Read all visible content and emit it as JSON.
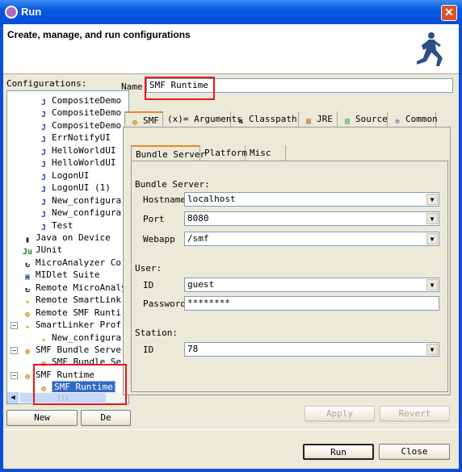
{
  "window": {
    "title": "Run",
    "close_icon": "close-icon"
  },
  "header": {
    "title": "Create, manage, and run configurations",
    "icon": "running-man-icon"
  },
  "configurations": {
    "label": "Configurations:",
    "items": [
      {
        "label": "CompositeDemo",
        "icon": "java-app-icon",
        "level": 2
      },
      {
        "label": "CompositeDemo",
        "icon": "java-app-icon",
        "level": 2
      },
      {
        "label": "CompositeDemo",
        "icon": "java-app-icon",
        "level": 2
      },
      {
        "label": "ErrNotifyUI",
        "icon": "java-app-icon",
        "level": 2
      },
      {
        "label": "HelloWorldUI",
        "icon": "java-app-icon",
        "level": 2
      },
      {
        "label": "HelloWorldUI",
        "icon": "java-app-icon",
        "level": 2
      },
      {
        "label": "LogonUI",
        "icon": "java-app-icon",
        "level": 2
      },
      {
        "label": "LogonUI (1)",
        "icon": "java-app-icon",
        "level": 2
      },
      {
        "label": "New_configura",
        "icon": "java-app-icon",
        "level": 2
      },
      {
        "label": "New_configura",
        "icon": "java-app-icon",
        "level": 2
      },
      {
        "label": "Test",
        "icon": "java-app-icon",
        "level": 2
      },
      {
        "label": "Java on Device",
        "icon": "device-icon",
        "level": 1
      },
      {
        "label": "JUnit",
        "icon": "junit-icon",
        "level": 1
      },
      {
        "label": "MicroAnalyzer Co",
        "icon": "analyzer-icon",
        "level": 1
      },
      {
        "label": "MIDlet Suite",
        "icon": "midlet-icon",
        "level": 1
      },
      {
        "label": "Remote MicroAnaly",
        "icon": "analyzer-icon",
        "level": 1
      },
      {
        "label": "Remote SmartLink",
        "icon": "smartlinker-icon",
        "level": 1
      },
      {
        "label": "Remote SMF Runti",
        "icon": "smf-icon",
        "level": 1
      },
      {
        "label": "SmartLinker Prof",
        "icon": "smartlinker-icon",
        "level": 1,
        "expanded": true
      },
      {
        "label": "New_configura",
        "icon": "smartlinker-icon",
        "level": 2
      },
      {
        "label": "SMF Bundle Serve",
        "icon": "smf-bundle-icon",
        "level": 1,
        "expanded": true
      },
      {
        "label": "SMF Bundle Se",
        "icon": "smf-bundle-icon",
        "level": 2
      },
      {
        "label": "SMF Runtime",
        "icon": "smf-icon",
        "level": 1,
        "expanded": true
      },
      {
        "label": "SMF Runtime",
        "icon": "smf-icon",
        "level": 2,
        "selected": true
      }
    ],
    "new_button": "New",
    "delete_button": "De"
  },
  "name": {
    "label": "Name:",
    "value": "SMF Runtime"
  },
  "tabs": [
    {
      "label": "SMF",
      "icon": "smf-icon",
      "active": true
    },
    {
      "label": "(x)= Arguments"
    },
    {
      "label": "Classpath",
      "icon": "classpath-icon"
    },
    {
      "label": "JRE",
      "icon": "jre-icon"
    },
    {
      "label": "Source",
      "icon": "source-icon"
    },
    {
      "label": "Common",
      "icon": "common-icon"
    }
  ],
  "subtabs": [
    {
      "label": "Bundle Server",
      "active": true
    },
    {
      "label": "Platform"
    },
    {
      "label": "Misc"
    }
  ],
  "bundle_server": {
    "heading": "Bundle Server:",
    "hostname": {
      "label": "Hostname",
      "value": "localhost"
    },
    "port": {
      "label": "Port",
      "value": "8080"
    },
    "webapp": {
      "label": "Webapp",
      "value": "/smf"
    }
  },
  "user": {
    "heading": "User:",
    "id": {
      "label": "ID",
      "value": "guest"
    },
    "password": {
      "label": "Password",
      "value": "********"
    }
  },
  "station": {
    "heading": "Station:",
    "id": {
      "label": "ID",
      "value": "78"
    }
  },
  "buttons": {
    "apply": "Apply",
    "revert": "Revert",
    "run": "Run",
    "close": "Close"
  },
  "colors": {
    "highlight": "#e0191c",
    "selection": "#316ac5",
    "titlebar": "#0a58e0"
  }
}
